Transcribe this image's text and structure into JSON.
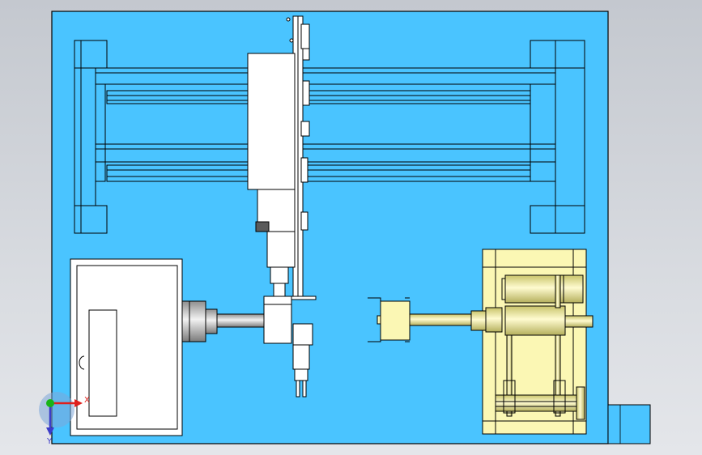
{
  "viewport": {
    "title": "",
    "background_color": "#d2d5da",
    "base_plate_color": "#4ac4ff",
    "part_color": "#ffffff",
    "cylinder_color": "#fbf7b4",
    "shaft_color": "#d4d4d4",
    "edge_color": "#000000"
  },
  "triad": {
    "x_label": "X",
    "y_label": "Y",
    "x_axis_color": "#e0201c",
    "y_axis_color": "#3c3cc8",
    "z_axis_color": "#18b418"
  },
  "components": [
    "base-plate",
    "gantry-frame-left",
    "gantry-frame-right",
    "linear-rails",
    "carriage-slider",
    "gripper-arm",
    "motor-housing",
    "drive-shaft-left",
    "clamp-head-left",
    "clamp-head-right",
    "drive-shaft-right",
    "pneumatic-cylinder-assembly",
    "corner-bracket"
  ]
}
